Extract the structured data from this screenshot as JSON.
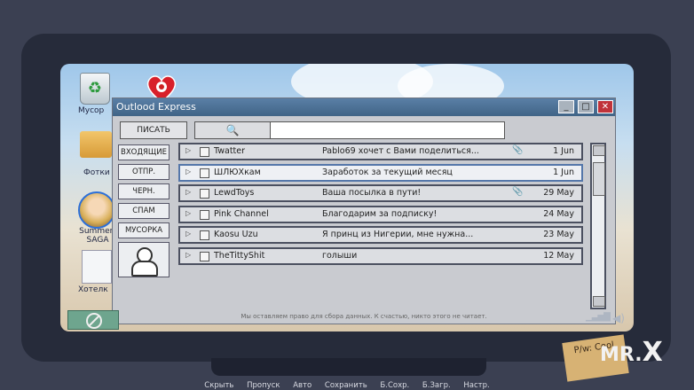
{
  "desktop": {
    "icons": [
      {
        "label": "Мусор"
      },
      {
        "label": "Фотки"
      },
      {
        "label": "Summert SAGA"
      },
      {
        "label": "Хотелк"
      }
    ]
  },
  "window": {
    "title": "Outlood Express",
    "controls": {
      "minimize": "_",
      "maximize": "□",
      "close": "✕"
    },
    "compose_label": "ПИСАТЬ",
    "search_icon": "🔍",
    "folders": [
      "ВХОДЯЩИЕ",
      "ОТПР.",
      "ЧЕРН.",
      "СПАМ",
      "МУСОРКА"
    ],
    "emails": [
      {
        "sender": "Twatter",
        "subject": "Pablo69 хочет с Вами поделиться...",
        "attachment": true,
        "date": "1 Jun",
        "selected": false
      },
      {
        "sender": "ШЛЮХкам",
        "subject": "Заработок за текущий месяц",
        "attachment": false,
        "date": "1 Jun",
        "selected": true
      },
      {
        "sender": "LewdToys",
        "subject": "Ваша посылка в пути!",
        "attachment": true,
        "date": "29 May",
        "selected": false
      },
      {
        "sender": "Pink Channel",
        "subject": "Благодарим за подписку!",
        "attachment": false,
        "date": "24 May",
        "selected": false
      },
      {
        "sender": "Kaosu Uzu",
        "subject": "Я принц из Нигерии, мне нужна...",
        "attachment": false,
        "date": "23 May",
        "selected": false
      },
      {
        "sender": "TheTittyShit",
        "subject": "голыши",
        "attachment": false,
        "date": "12 May",
        "selected": false
      }
    ],
    "disclaimer": "Мы оставляем право для сбора данных. К счастью, никто этого не читает."
  },
  "quick_menu": [
    "Скрыть",
    "Пропуск",
    "Авто",
    "Сохранить",
    "Б.Сохр.",
    "Б.Загр.",
    "Настр."
  ],
  "sticky_note": "P/w: Cool",
  "watermark": {
    "prefix": "MR.",
    "letter": "X"
  }
}
